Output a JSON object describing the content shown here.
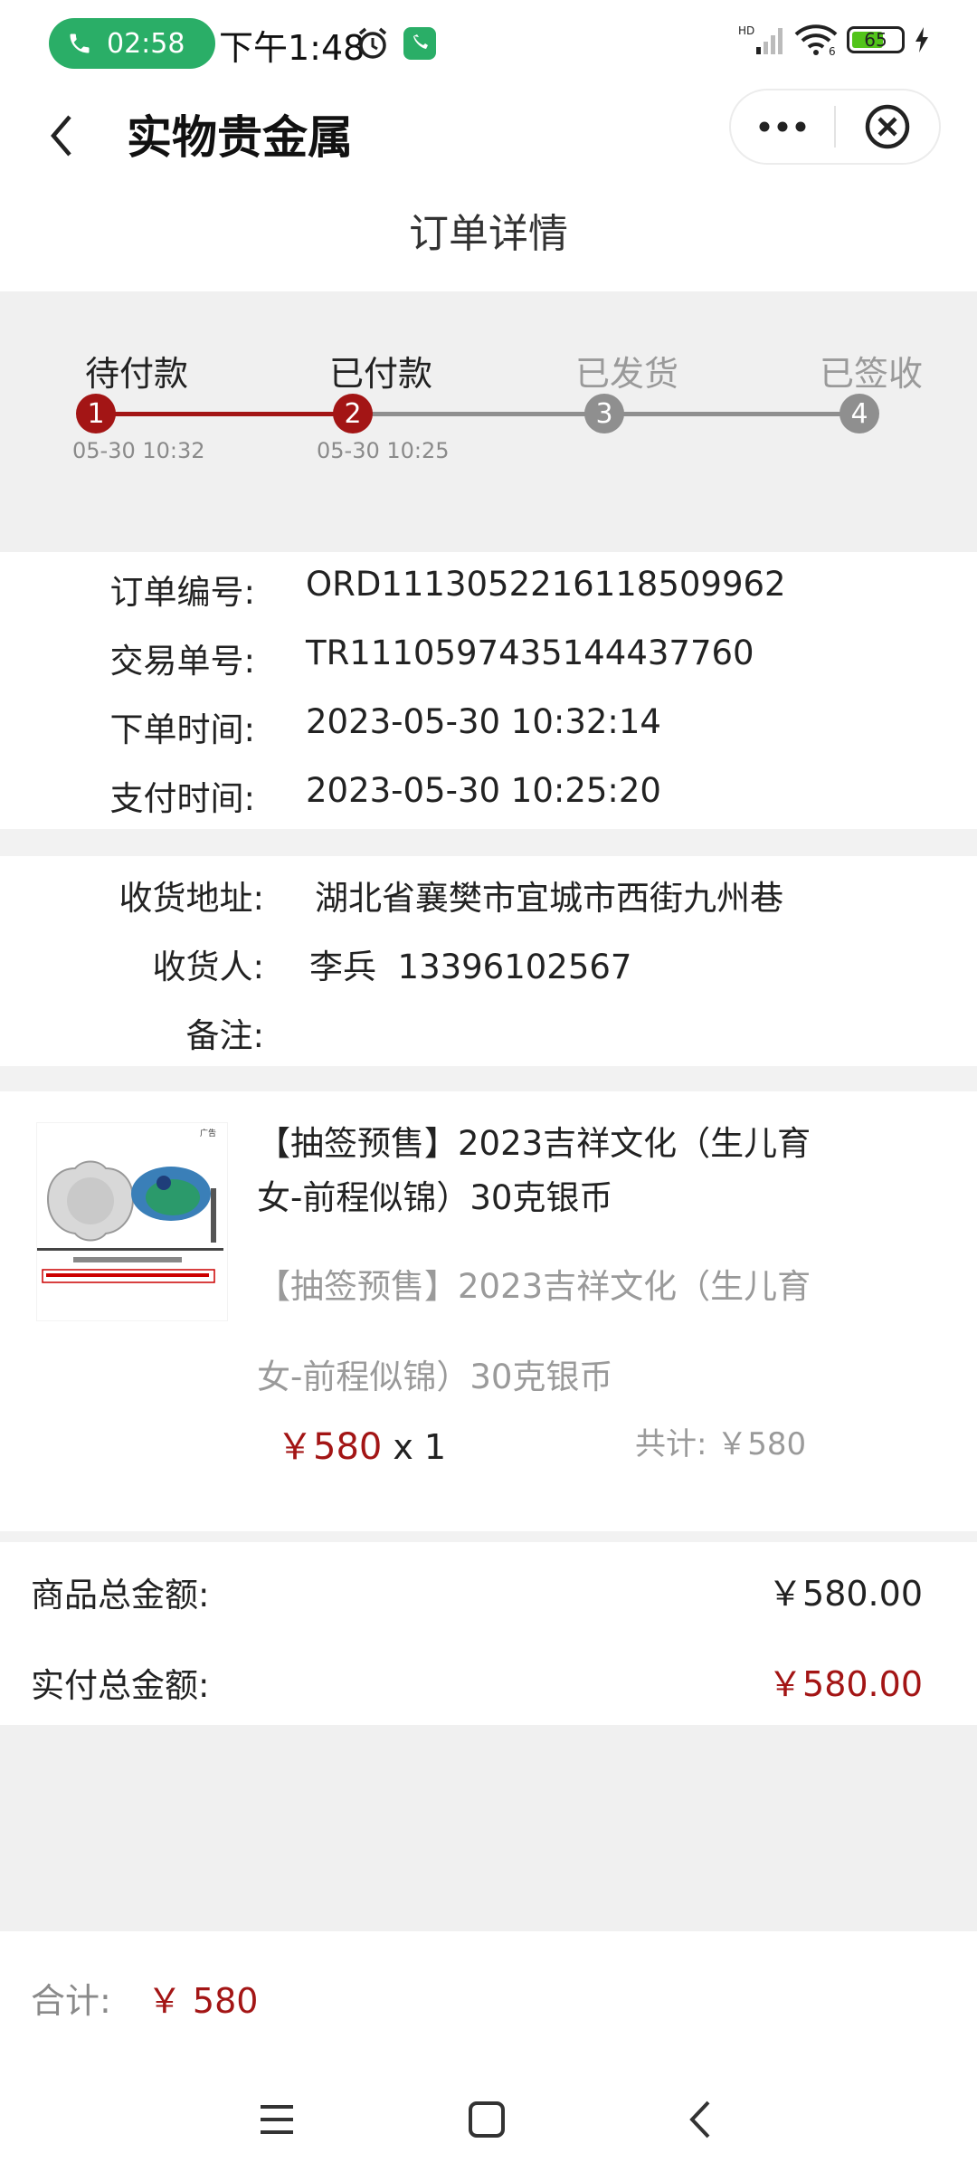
{
  "status_bar": {
    "call_time": "02:58",
    "time": "下午1:48",
    "network": "HD",
    "wifi_label": "6",
    "battery": "65",
    "battery_level": 0.65
  },
  "header": {
    "title": "实物贵金属",
    "page_title": "订单详情"
  },
  "progress": {
    "steps": [
      {
        "label": "待付款",
        "number": "1",
        "time": "05-30 10:32",
        "active": true
      },
      {
        "label": "已付款",
        "number": "2",
        "time": "05-30 10:25",
        "active": true
      },
      {
        "label": "已发货",
        "number": "3",
        "time": "",
        "active": false
      },
      {
        "label": "已签收",
        "number": "4",
        "time": "",
        "active": false
      }
    ]
  },
  "order": {
    "order_no_label": "订单编号:",
    "order_no": "ORD1113052216118509962",
    "trade_no_label": "交易单号:",
    "trade_no": "TR1110597435144437760",
    "order_time_label": "下单时间:",
    "order_time": "2023-05-30 10:32:14",
    "pay_time_label": "支付时间:",
    "pay_time": "2023-05-30 10:25:20"
  },
  "shipping": {
    "address_label": "收货地址:",
    "address": "湖北省襄樊市宜城市西街九州巷",
    "receiver_label": "收货人:",
    "receiver": "李兵  13396102567",
    "note_label": "备注:",
    "note": ""
  },
  "product": {
    "title": "【抽签预售】2023吉祥文化（生儿育女-前程似锦）30克银币",
    "subtitle": "【抽签预售】2023吉祥文化（生儿育女-前程似锦）30克银币",
    "price": "￥580",
    "qty": "x 1",
    "subtotal": "共计: ￥580",
    "image_ad_mark": "广告"
  },
  "summary": {
    "goods_total_label": "商品总金额:",
    "goods_total": "￥580.00",
    "paid_total_label": "实付总金额:",
    "paid_total": "￥580.00"
  },
  "footer": {
    "total_label": "合计:",
    "total": "￥ 580"
  },
  "colors": {
    "accent_red": "#a31515",
    "step_grey": "#8f8f8f",
    "wechat_green": "#2aae67"
  }
}
